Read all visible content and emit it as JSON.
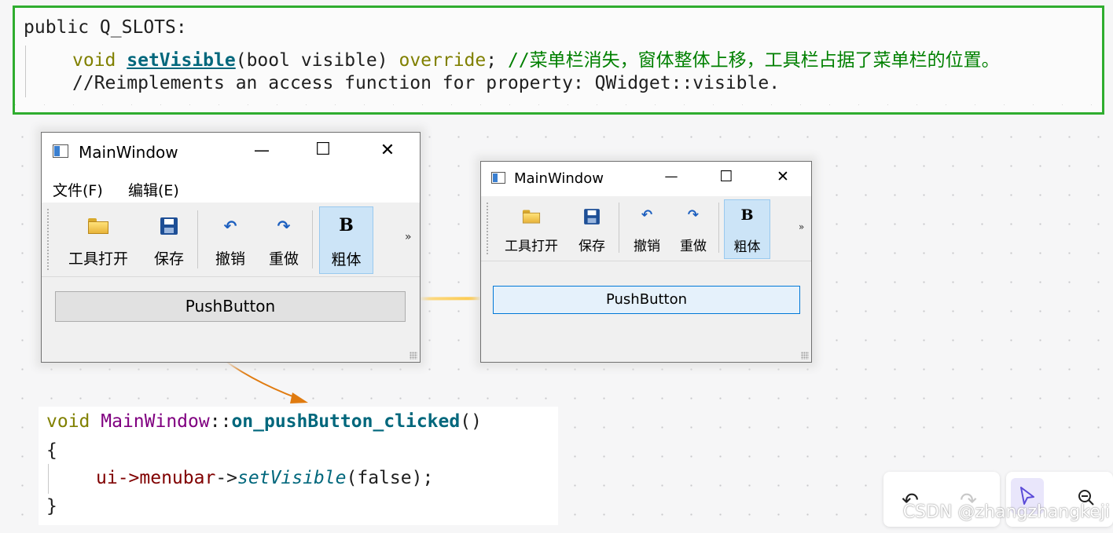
{
  "code_top": {
    "line1": "public Q_SLOTS:",
    "line2": {
      "kw": "void",
      "fn": "setVisible",
      "args": "(bool visible)",
      "override": "override",
      "semi": ";",
      "comment": "//菜单栏消失，窗体整体上移，工具栏占据了菜单栏的位置。"
    },
    "line3": "//Reimplements an access function for property: QWidget::visible."
  },
  "window_before": {
    "title": "MainWindow",
    "min": "—",
    "max": "☐",
    "close": "✕",
    "menus": [
      "文件(F)",
      "编辑(E)"
    ],
    "toolbar": [
      {
        "label": "工具打开",
        "icon": "folder-open-icon"
      },
      {
        "label": "保存",
        "icon": "save-icon"
      },
      {
        "label": "撤销",
        "icon": "undo-icon"
      },
      {
        "label": "重做",
        "icon": "redo-icon"
      },
      {
        "label": "粗体",
        "icon": "bold-icon",
        "checked": true
      }
    ],
    "overflow": "»",
    "push_button": "PushButton"
  },
  "window_after": {
    "title": "MainWindow",
    "min": "—",
    "max": "☐",
    "close": "✕",
    "toolbar": [
      {
        "label": "工具打开",
        "icon": "folder-open-icon"
      },
      {
        "label": "保存",
        "icon": "save-icon"
      },
      {
        "label": "撤销",
        "icon": "undo-icon"
      },
      {
        "label": "重做",
        "icon": "redo-icon"
      },
      {
        "label": "粗体",
        "icon": "bold-icon",
        "checked": true
      }
    ],
    "overflow": "»",
    "push_button": "PushButton"
  },
  "code_bottom": {
    "void": "void",
    "cls": "MainWindow",
    "sep": "::",
    "fn": "on_pushButton_clicked",
    "parens": "()",
    "open": "{",
    "ui": "ui->",
    "member": "menubar",
    "arrow": "->",
    "call": "setVisible",
    "args": "(false);",
    "close": "}"
  },
  "canvas_tools": {
    "undo": "↶",
    "redo": "↷",
    "select": "select-pointer-icon",
    "zoom_out": "zoom-out-icon"
  },
  "watermark": "CSDN @zhangzhangkeji",
  "colors": {
    "frame_green": "#2fad2f",
    "arrow_gold": "#ffb300",
    "arrow_orange": "#e07b10",
    "checked_bg": "#cce4f7"
  }
}
